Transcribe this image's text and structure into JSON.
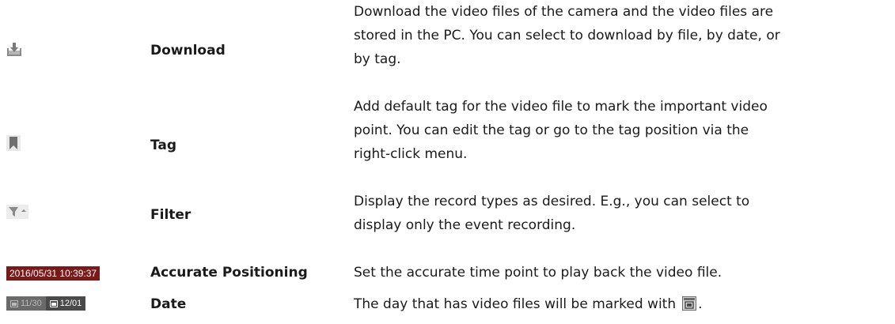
{
  "rows": [
    {
      "icon": "download-tray-icon",
      "name": "Download",
      "desc_lines": [
        "Download the video files of the camera and the video files are",
        "stored in the PC. You can select to download by file, by date, or",
        "by tag."
      ]
    },
    {
      "icon": "bookmark-icon",
      "name": "Tag",
      "desc_lines": [
        "Add default tag for the video file to mark the important video",
        "point. You can edit the tag or go to the tag position via the",
        "right-click menu."
      ]
    },
    {
      "icon": "filter-funnel-icon",
      "name": "Filter",
      "desc_lines": [
        "Display the record types as desired. E.g., you can select to",
        "display only the event recording."
      ]
    },
    {
      "icon": "timestamp-box",
      "timestamp": "2016/05/31 10:39:37",
      "name": "Accurate Positioning",
      "desc_lines": [
        "Set the accurate time point to play back the video file."
      ]
    },
    {
      "icon": "date-selector",
      "date_prev": "11/30",
      "date_current": "12/01",
      "name": "Date",
      "desc_prefix": "The day that has video files will be marked with",
      "desc_suffix": "."
    }
  ],
  "colors": {
    "icon_gray": "#9a9a9a",
    "timestamp_bg": "#7b1818",
    "date_off_bg": "#6a6a6a",
    "date_on_bg": "#4a4a4a"
  }
}
